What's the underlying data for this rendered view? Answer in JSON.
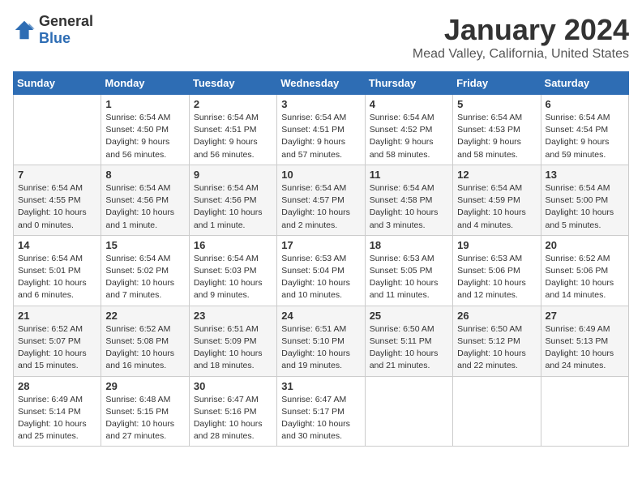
{
  "logo": {
    "general": "General",
    "blue": "Blue"
  },
  "title": {
    "month": "January 2024",
    "location": "Mead Valley, California, United States"
  },
  "days_of_week": [
    "Sunday",
    "Monday",
    "Tuesday",
    "Wednesday",
    "Thursday",
    "Friday",
    "Saturday"
  ],
  "weeks": [
    [
      {
        "day": "",
        "sunrise": "",
        "sunset": "",
        "daylight": ""
      },
      {
        "day": "1",
        "sunrise": "Sunrise: 6:54 AM",
        "sunset": "Sunset: 4:50 PM",
        "daylight": "Daylight: 9 hours and 56 minutes."
      },
      {
        "day": "2",
        "sunrise": "Sunrise: 6:54 AM",
        "sunset": "Sunset: 4:51 PM",
        "daylight": "Daylight: 9 hours and 56 minutes."
      },
      {
        "day": "3",
        "sunrise": "Sunrise: 6:54 AM",
        "sunset": "Sunset: 4:51 PM",
        "daylight": "Daylight: 9 hours and 57 minutes."
      },
      {
        "day": "4",
        "sunrise": "Sunrise: 6:54 AM",
        "sunset": "Sunset: 4:52 PM",
        "daylight": "Daylight: 9 hours and 58 minutes."
      },
      {
        "day": "5",
        "sunrise": "Sunrise: 6:54 AM",
        "sunset": "Sunset: 4:53 PM",
        "daylight": "Daylight: 9 hours and 58 minutes."
      },
      {
        "day": "6",
        "sunrise": "Sunrise: 6:54 AM",
        "sunset": "Sunset: 4:54 PM",
        "daylight": "Daylight: 9 hours and 59 minutes."
      }
    ],
    [
      {
        "day": "7",
        "sunrise": "Sunrise: 6:54 AM",
        "sunset": "Sunset: 4:55 PM",
        "daylight": "Daylight: 10 hours and 0 minutes."
      },
      {
        "day": "8",
        "sunrise": "Sunrise: 6:54 AM",
        "sunset": "Sunset: 4:56 PM",
        "daylight": "Daylight: 10 hours and 1 minute."
      },
      {
        "day": "9",
        "sunrise": "Sunrise: 6:54 AM",
        "sunset": "Sunset: 4:56 PM",
        "daylight": "Daylight: 10 hours and 1 minute."
      },
      {
        "day": "10",
        "sunrise": "Sunrise: 6:54 AM",
        "sunset": "Sunset: 4:57 PM",
        "daylight": "Daylight: 10 hours and 2 minutes."
      },
      {
        "day": "11",
        "sunrise": "Sunrise: 6:54 AM",
        "sunset": "Sunset: 4:58 PM",
        "daylight": "Daylight: 10 hours and 3 minutes."
      },
      {
        "day": "12",
        "sunrise": "Sunrise: 6:54 AM",
        "sunset": "Sunset: 4:59 PM",
        "daylight": "Daylight: 10 hours and 4 minutes."
      },
      {
        "day": "13",
        "sunrise": "Sunrise: 6:54 AM",
        "sunset": "Sunset: 5:00 PM",
        "daylight": "Daylight: 10 hours and 5 minutes."
      }
    ],
    [
      {
        "day": "14",
        "sunrise": "Sunrise: 6:54 AM",
        "sunset": "Sunset: 5:01 PM",
        "daylight": "Daylight: 10 hours and 6 minutes."
      },
      {
        "day": "15",
        "sunrise": "Sunrise: 6:54 AM",
        "sunset": "Sunset: 5:02 PM",
        "daylight": "Daylight: 10 hours and 7 minutes."
      },
      {
        "day": "16",
        "sunrise": "Sunrise: 6:54 AM",
        "sunset": "Sunset: 5:03 PM",
        "daylight": "Daylight: 10 hours and 9 minutes."
      },
      {
        "day": "17",
        "sunrise": "Sunrise: 6:53 AM",
        "sunset": "Sunset: 5:04 PM",
        "daylight": "Daylight: 10 hours and 10 minutes."
      },
      {
        "day": "18",
        "sunrise": "Sunrise: 6:53 AM",
        "sunset": "Sunset: 5:05 PM",
        "daylight": "Daylight: 10 hours and 11 minutes."
      },
      {
        "day": "19",
        "sunrise": "Sunrise: 6:53 AM",
        "sunset": "Sunset: 5:06 PM",
        "daylight": "Daylight: 10 hours and 12 minutes."
      },
      {
        "day": "20",
        "sunrise": "Sunrise: 6:52 AM",
        "sunset": "Sunset: 5:06 PM",
        "daylight": "Daylight: 10 hours and 14 minutes."
      }
    ],
    [
      {
        "day": "21",
        "sunrise": "Sunrise: 6:52 AM",
        "sunset": "Sunset: 5:07 PM",
        "daylight": "Daylight: 10 hours and 15 minutes."
      },
      {
        "day": "22",
        "sunrise": "Sunrise: 6:52 AM",
        "sunset": "Sunset: 5:08 PM",
        "daylight": "Daylight: 10 hours and 16 minutes."
      },
      {
        "day": "23",
        "sunrise": "Sunrise: 6:51 AM",
        "sunset": "Sunset: 5:09 PM",
        "daylight": "Daylight: 10 hours and 18 minutes."
      },
      {
        "day": "24",
        "sunrise": "Sunrise: 6:51 AM",
        "sunset": "Sunset: 5:10 PM",
        "daylight": "Daylight: 10 hours and 19 minutes."
      },
      {
        "day": "25",
        "sunrise": "Sunrise: 6:50 AM",
        "sunset": "Sunset: 5:11 PM",
        "daylight": "Daylight: 10 hours and 21 minutes."
      },
      {
        "day": "26",
        "sunrise": "Sunrise: 6:50 AM",
        "sunset": "Sunset: 5:12 PM",
        "daylight": "Daylight: 10 hours and 22 minutes."
      },
      {
        "day": "27",
        "sunrise": "Sunrise: 6:49 AM",
        "sunset": "Sunset: 5:13 PM",
        "daylight": "Daylight: 10 hours and 24 minutes."
      }
    ],
    [
      {
        "day": "28",
        "sunrise": "Sunrise: 6:49 AM",
        "sunset": "Sunset: 5:14 PM",
        "daylight": "Daylight: 10 hours and 25 minutes."
      },
      {
        "day": "29",
        "sunrise": "Sunrise: 6:48 AM",
        "sunset": "Sunset: 5:15 PM",
        "daylight": "Daylight: 10 hours and 27 minutes."
      },
      {
        "day": "30",
        "sunrise": "Sunrise: 6:47 AM",
        "sunset": "Sunset: 5:16 PM",
        "daylight": "Daylight: 10 hours and 28 minutes."
      },
      {
        "day": "31",
        "sunrise": "Sunrise: 6:47 AM",
        "sunset": "Sunset: 5:17 PM",
        "daylight": "Daylight: 10 hours and 30 minutes."
      },
      {
        "day": "",
        "sunrise": "",
        "sunset": "",
        "daylight": ""
      },
      {
        "day": "",
        "sunrise": "",
        "sunset": "",
        "daylight": ""
      },
      {
        "day": "",
        "sunrise": "",
        "sunset": "",
        "daylight": ""
      }
    ]
  ]
}
